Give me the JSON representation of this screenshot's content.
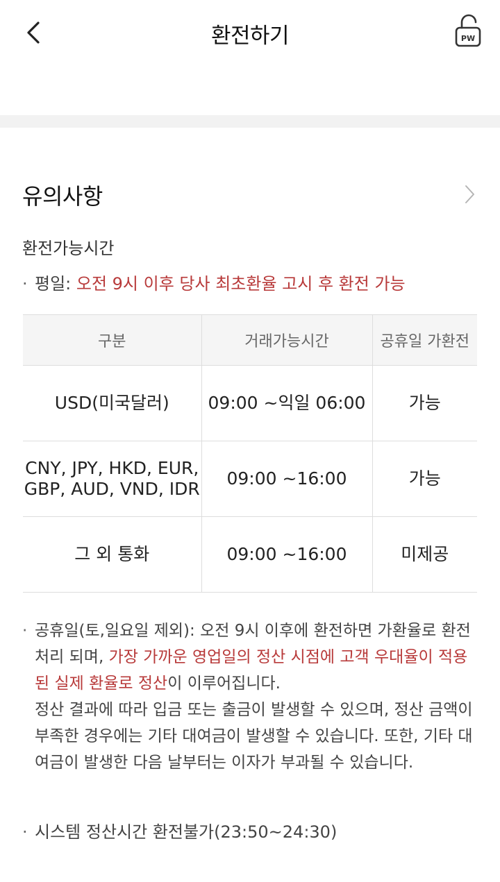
{
  "header": {
    "title": "환전하기",
    "pw_label": "PW"
  },
  "notice": {
    "title": "유의사항"
  },
  "hours": {
    "heading": "환전가능시간",
    "weekday_label": "평일: ",
    "weekday_text": "오전 9시 이후 당사 최초환율 고시 후 환전 가능"
  },
  "table": {
    "headers": [
      "구분",
      "거래가능시간",
      "공휴일 가환전"
    ],
    "rows": [
      {
        "currency": "USD(미국달러)",
        "time": "09:00 ~익일 06:00",
        "holiday": "가능"
      },
      {
        "currency_line1": "CNY, JPY, HKD, EUR,",
        "currency_line2": "GBP, AUD, VND, IDR",
        "time": "09:00 ~16:00",
        "holiday": "가능"
      },
      {
        "currency": "그 외 통화",
        "time": "09:00 ~16:00",
        "holiday": "미제공"
      }
    ]
  },
  "holiday_note": {
    "part1": "공휴일(토,일요일 제외): 오전 9시 이후에 환전하면 가환율로 환전처리 되며, ",
    "part2_red": "가장 가까운 영업일의 정산 시점에 고객 우대율이 적용된 실제 환율로 정산",
    "part3": "이 이루어집니다.",
    "part4": "정산 결과에 따라 입금 또는 출금이 발생할 수 있으며, 정산 금액이 부족한 경우에는 기타 대여금이 발생할 수 있습니다. 또한, 기타 대여금이 발생한 다음 날부터는 이자가 부과될 수 있습니다."
  },
  "system_note": "시스템 정산시간 환전불가(23:50~24:30)",
  "colors": {
    "accent_red": "#b83a3a",
    "band_gray": "#f2f2f2",
    "table_header_bg": "#f5f5f5"
  },
  "icons": {
    "back": "chevron-left-icon",
    "password": "lock-pw-icon",
    "more": "chevron-right-icon"
  }
}
